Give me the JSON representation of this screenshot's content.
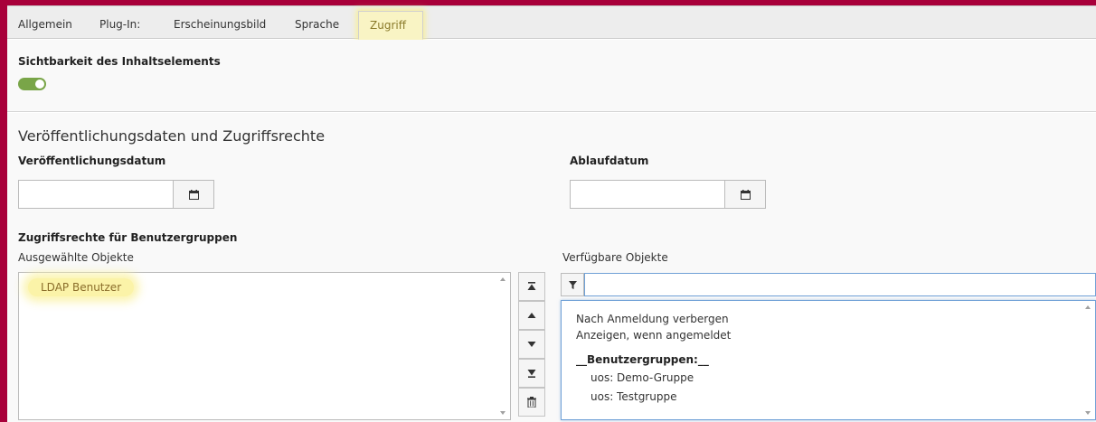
{
  "tabs": [
    {
      "label": "Allgemein"
    },
    {
      "label": "Plug-In:"
    },
    {
      "label": "Erscheinungsbild"
    },
    {
      "label": "Sprache"
    },
    {
      "label": "Zugriff"
    }
  ],
  "visibility": {
    "label": "Sichtbarkeit des Inhaltselements",
    "enabled": true,
    "toggle_color": "#79a548"
  },
  "publishing": {
    "section_title": "Veröffentlichungsdaten und Zugriffsrechte",
    "start_label": "Veröffentlichungsdatum",
    "start_value": "",
    "end_label": "Ablaufdatum",
    "end_value": "",
    "calendar_icon": "calendar-icon"
  },
  "access": {
    "heading": "Zugriffsrechte für Benutzergruppen",
    "selected_label": "Ausgewählte Objekte",
    "selected_items": [
      "LDAP Benutzer"
    ],
    "available_label": "Verfügbare Objekte",
    "filter_value": "",
    "available_items": {
      "hide": "Nach Anmeldung verbergen",
      "show": "Anzeigen, wenn angemeldet",
      "group_header": "__Benutzergruppen:__",
      "groups": [
        "uos: Demo-Gruppe",
        "uos: Testgruppe"
      ]
    },
    "move_buttons": [
      "move-to-top-icon",
      "move-up-icon",
      "move-down-icon",
      "move-to-bottom-icon",
      "delete-icon"
    ]
  },
  "colors": {
    "frame": "#a8003a",
    "active_tab_highlight": "#f9f4c4",
    "selected_highlight": "#fbf3a8"
  }
}
